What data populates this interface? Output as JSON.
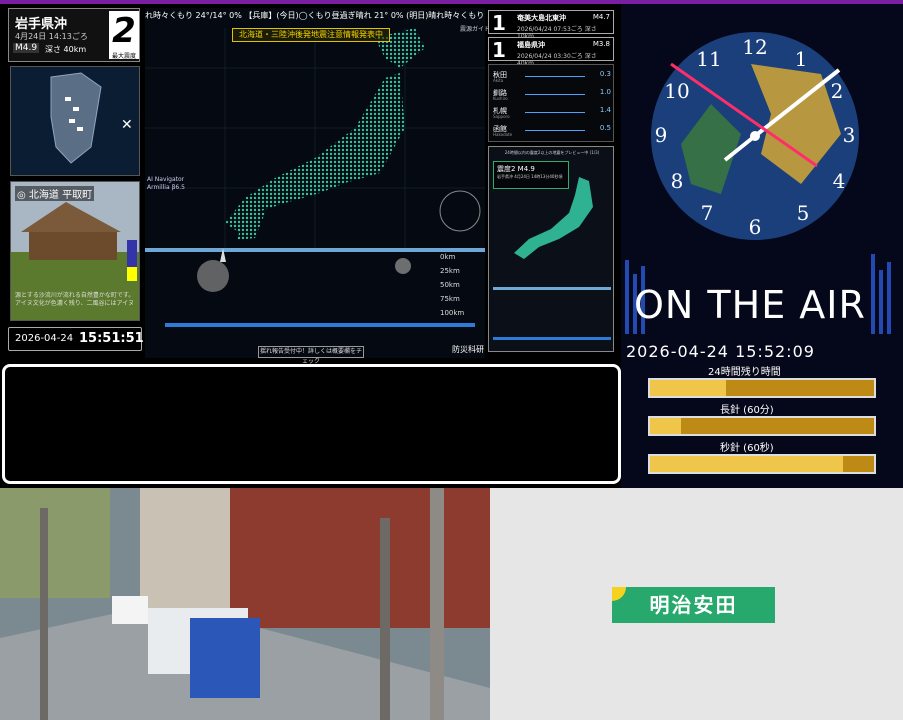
{
  "quake": {
    "region": "岩手県沖",
    "time": "4月24日 14:13ごろ",
    "magnitude": "M4.9",
    "depth": "深さ 40km",
    "intensity": "2",
    "intensity_label": "最大震度"
  },
  "photo": {
    "title": "◎ 北海道 平取町",
    "text": "源とする沙流川が流れる自然豊かな町です。アイヌ文化が色濃く残り、二風谷にはアイヌ"
  },
  "left_clock": {
    "date": "2026-04-24",
    "time": "15:51:51"
  },
  "ticker": "れ時々くもり 24°/14° 0% 【兵庫】(今日)◯くもり昼過ぎ晴れ 21° 0% (明日)晴れ時々くもり 23°/14°",
  "warning_banner": "北海道・三陸沖後発地震注意情報発表中",
  "region_guide": "震源ガイド",
  "ai_navigator": [
    "AI Navigator",
    "Armillia β6.5"
  ],
  "depth_scale": [
    "0km",
    "25km",
    "50km",
    "75km",
    "100km"
  ],
  "check_button": "揺れ報告受付中！詳しくは概要欄をチェック",
  "bosai_label": "防災科研",
  "recent_quakes": [
    {
      "num": "1",
      "name": "奄美大島北東沖",
      "mag": "M4.7",
      "detail": "2026/04/24 07:53ごろ 深さ10km"
    },
    {
      "num": "1",
      "name": "福島県沖",
      "mag": "M3.8",
      "detail": "2026/04/24 03:30ごろ 深さ40km"
    }
  ],
  "stations": [
    {
      "name": "秋田",
      "sub": "Akita",
      "val": "0.3"
    },
    {
      "name": "釧路",
      "sub": "Kushiro",
      "val": "1.0"
    },
    {
      "name": "札幌",
      "sub": "Sapporo",
      "val": "1.4"
    },
    {
      "name": "函館",
      "sub": "Hakodate",
      "val": "0.5"
    }
  ],
  "preview": {
    "head": "24時間以内の震度2以上の地震をプレビュー中 (1/3)",
    "title": "震度2 M4.9",
    "sub": "岩手県沖 4月24日 14時13分40秒頃"
  },
  "right_panel": {
    "on_air": "ON THE AIR",
    "datetime": "2026-04-24 15:52:09",
    "bars": [
      {
        "label": "24時間残り時間",
        "fraction": 0.34
      },
      {
        "label": "長針 (60分)",
        "fraction": 0.14
      },
      {
        "label": "秒針 (60秒)",
        "fraction": 0.86
      }
    ]
  },
  "sign": "明治安田",
  "colors": {
    "accent": "#7b1fa2",
    "bar": "#bd8a16",
    "bar_fill": "#f0c64a",
    "sign": "#27a86c"
  }
}
